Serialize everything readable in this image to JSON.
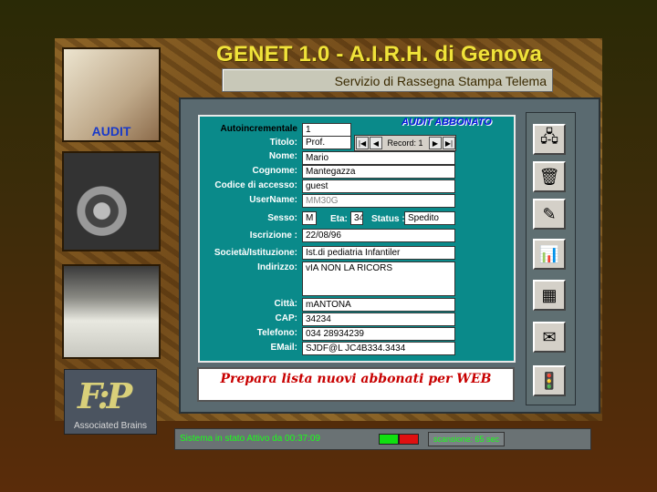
{
  "header": {
    "title": "GENET 1.0 - A.I.R.H. di Genova",
    "subtitle": "Servizio di Rassegna Stampa Telema"
  },
  "side": {
    "audit_label": "AUDIT",
    "logo_mark": "F:P",
    "logo_text": "Associated Brains"
  },
  "form": {
    "header": "AUDIT ABBONATO",
    "labels": {
      "autoincrementale": "Autoincrementale",
      "titolo": "Titolo:",
      "nome": "Nome:",
      "cognome": "Cognome:",
      "codice": "Codice di accesso:",
      "username": "UserName:",
      "sesso": "Sesso:",
      "eta": "Eta:",
      "status": "Status :",
      "iscrizione": "Iscrizione :",
      "societa": "Società/Istituzione:",
      "indirizzo": "Indirizzo:",
      "citta": "Città:",
      "cap": "CAP:",
      "telefono": "Telefono:",
      "email": "EMail:"
    },
    "values": {
      "autoincrementale": "1",
      "titolo": "Prof.",
      "nome": "Mario",
      "cognome": "Mantegazza",
      "codice": "guest",
      "username": "MM30G",
      "sesso": "M",
      "eta": "34",
      "status": "Spedito",
      "iscrizione": "22/08/96",
      "societa": "Ist.di pediatria Infantiler",
      "indirizzo": "vIA NON LA RICORS",
      "citta": "mANTONA",
      "cap": "34234",
      "telefono": "034 28934239",
      "email": "SJDF@L JC4B334.3434"
    },
    "nav": {
      "record_label": "Record: 1"
    }
  },
  "message": "Prepara lista nuovi abbonati per WEB",
  "status": {
    "text": "Sistema in stato Attivo da 00:37:09",
    "scan": "scansione: 65 sec"
  },
  "colors": {
    "led_green": "#10e010",
    "led_red": "#e01010",
    "message": "#c80000"
  },
  "tools": [
    "server-icon",
    "trash-icon",
    "edit-icon",
    "chart-icon",
    "calculator-icon",
    "envelope-icon",
    "traffic-light-icon"
  ]
}
